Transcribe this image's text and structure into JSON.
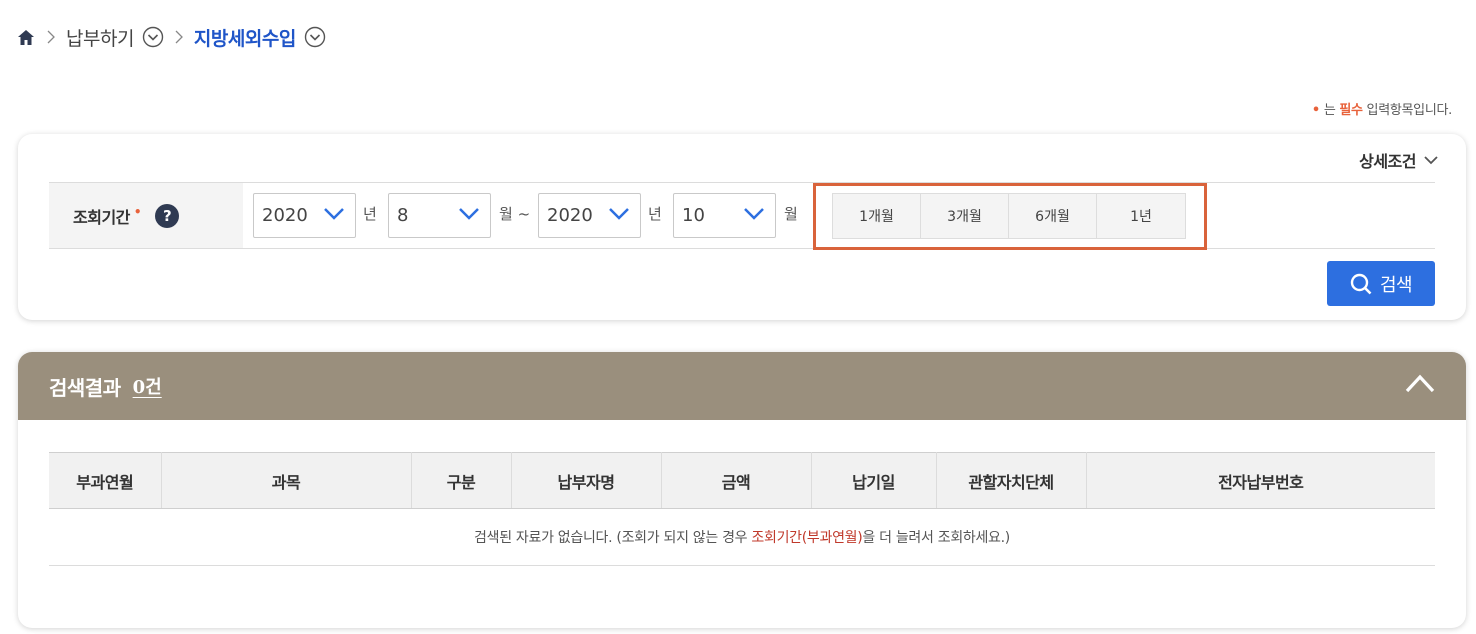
{
  "breadcrumb": {
    "level1": "납부하기",
    "level2": "지방세외수입"
  },
  "required_note": {
    "bullet": "•",
    "prefix": "는 ",
    "required_word": "필수",
    "suffix": " 입력항목입니다."
  },
  "search": {
    "detail_toggle_label": "상세조건",
    "period_label": "조회기간",
    "required_mark": "•",
    "help_symbol": "?",
    "start_year": "2020",
    "start_month": "8",
    "end_year": "2020",
    "end_month": "10",
    "year_unit": "년",
    "month_unit_from": "월 ~",
    "month_unit_to": "월",
    "quick_periods": [
      "1개월",
      "3개월",
      "6개월",
      "1년"
    ],
    "search_button_label": "검색"
  },
  "results": {
    "title": "검색결과",
    "count": "0건",
    "columns": [
      "부과연월",
      "과목",
      "구분",
      "납부자명",
      "금액",
      "납기일",
      "관할자치단체",
      "전자납부번호"
    ],
    "empty_message_prefix": "검색된 자료가 없습니다. (조회가 되지 않는 경우 ",
    "empty_message_highlight": "조회기간(부과연월)",
    "empty_message_suffix": "을 더 늘려서 조회하세요.)"
  },
  "colors": {
    "accent_blue": "#2d6fe0",
    "breadcrumb_active": "#1f55c8",
    "highlight_box": "#d9633b",
    "required_orange": "#e8623b",
    "result_header": "#9a8f7d"
  }
}
